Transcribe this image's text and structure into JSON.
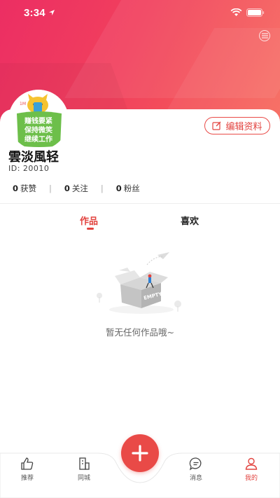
{
  "status_bar": {
    "time": "3:34"
  },
  "profile": {
    "name": "雲淡風轻",
    "id_line": "ID:  20010",
    "edit_label": "编辑资料",
    "avatar_text_1": "赚钱要紧",
    "avatar_text_2": "保持微笑",
    "avatar_text_3": "继续工作"
  },
  "stats": [
    {
      "value": "0",
      "label": "获赞"
    },
    {
      "value": "0",
      "label": "关注"
    },
    {
      "value": "0",
      "label": "粉丝"
    }
  ],
  "content_tabs": [
    {
      "label": "作品",
      "active": true
    },
    {
      "label": "喜欢",
      "active": false
    }
  ],
  "empty_state": {
    "illustration_text": "EMPTY",
    "message": "暂无任何作品哦~"
  },
  "tab_bar": {
    "items": [
      {
        "label": "推荐",
        "icon": "thumbs-up-icon"
      },
      {
        "label": "同城",
        "icon": "building-icon"
      },
      {
        "label": "消息",
        "icon": "chat-bubble-icon"
      },
      {
        "label": "我的",
        "icon": "person-icon",
        "active": true
      }
    ]
  },
  "colors": {
    "accent": "#e2433f",
    "header_start": "#ec2e63",
    "header_end": "#f76a5e"
  }
}
